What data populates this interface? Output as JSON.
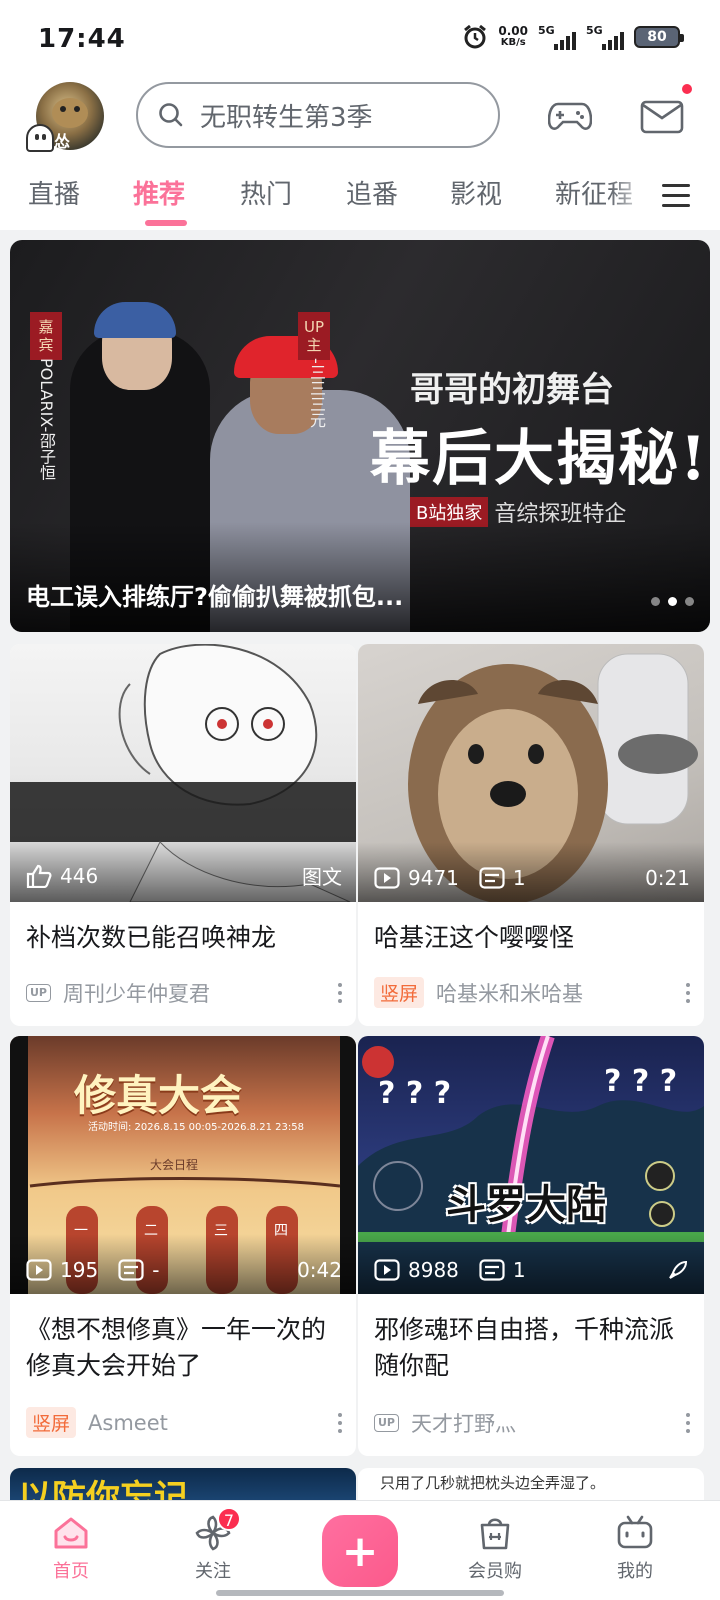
{
  "status_bar": {
    "time": "17:44",
    "net_speed": "0.00",
    "net_unit": "KB/s",
    "sim1": "5G",
    "sim2": "5G",
    "battery": "80"
  },
  "header": {
    "avatar_badge": "怂",
    "search_placeholder": "无职转生第3季",
    "icons": [
      "gamepad-icon",
      "mail-icon"
    ]
  },
  "tabs": [
    {
      "label": "直播",
      "active": false
    },
    {
      "label": "推荐",
      "active": true
    },
    {
      "label": "热门",
      "active": false
    },
    {
      "label": "追番",
      "active": false
    },
    {
      "label": "影视",
      "active": false
    },
    {
      "label": "新征程",
      "active": false
    }
  ],
  "banner": {
    "guest_tag": "嘉宾",
    "guest_name": "POLARIX-邵子恒",
    "up_tag": "UP主",
    "up_name": "-三三三元",
    "title_line1": "哥哥的初舞台",
    "title_line2": "幕后大揭秘!",
    "exclusive": "B站独家",
    "subtitle": "音综探班特企",
    "caption": "电工误入排练厅?偷偷扒舞被抓包...",
    "dots": 3,
    "active_dot": 2
  },
  "cards": [
    {
      "title": "补档次数已能召唤神龙",
      "stat1": "446",
      "stat1_icon": "thumbs-up-icon",
      "right_label": "图文",
      "author_tag": "UP",
      "author": "周刊少年仲夏君"
    },
    {
      "title": "哈基汪这个嘤嘤怪",
      "stat1": "9471",
      "stat2": "1",
      "duration": "0:21",
      "author_tag": "竖屏",
      "author": "哈基米和米哈基"
    },
    {
      "title": "《想不想修真》一年一次的修真大会开始了",
      "stat1": "195",
      "stat2": "-",
      "duration": "0:42",
      "author_tag": "竖屏",
      "author": "Asmeet",
      "thumb_title": "修真大会",
      "thumb_time": "活动时间: 2026.8.15 00:05-2026.8.21 23:58",
      "thumb_sub": "大会日程",
      "thumb_nums": [
        "一",
        "二",
        "三",
        "四"
      ]
    },
    {
      "title": "邪修魂环自由搭，千种流派随你配",
      "stat1": "8988",
      "stat2": "1",
      "author_tag": "UP",
      "author": "天才打野灬",
      "thumb_text": "斗罗大陆"
    }
  ],
  "partial_cards": {
    "left_text": "以防你忘记",
    "right_text": "只用了几秒就把枕头边全弄湿了。"
  },
  "bottom_nav": [
    {
      "label": "首页",
      "active": true
    },
    {
      "label": "关注",
      "badge": "7"
    },
    {
      "label": "+"
    },
    {
      "label": "会员购"
    },
    {
      "label": "我的"
    }
  ],
  "colors": {
    "accent": "#fb7299",
    "badge": "#fb2e50",
    "vertical_tag": "#f26b3a"
  }
}
